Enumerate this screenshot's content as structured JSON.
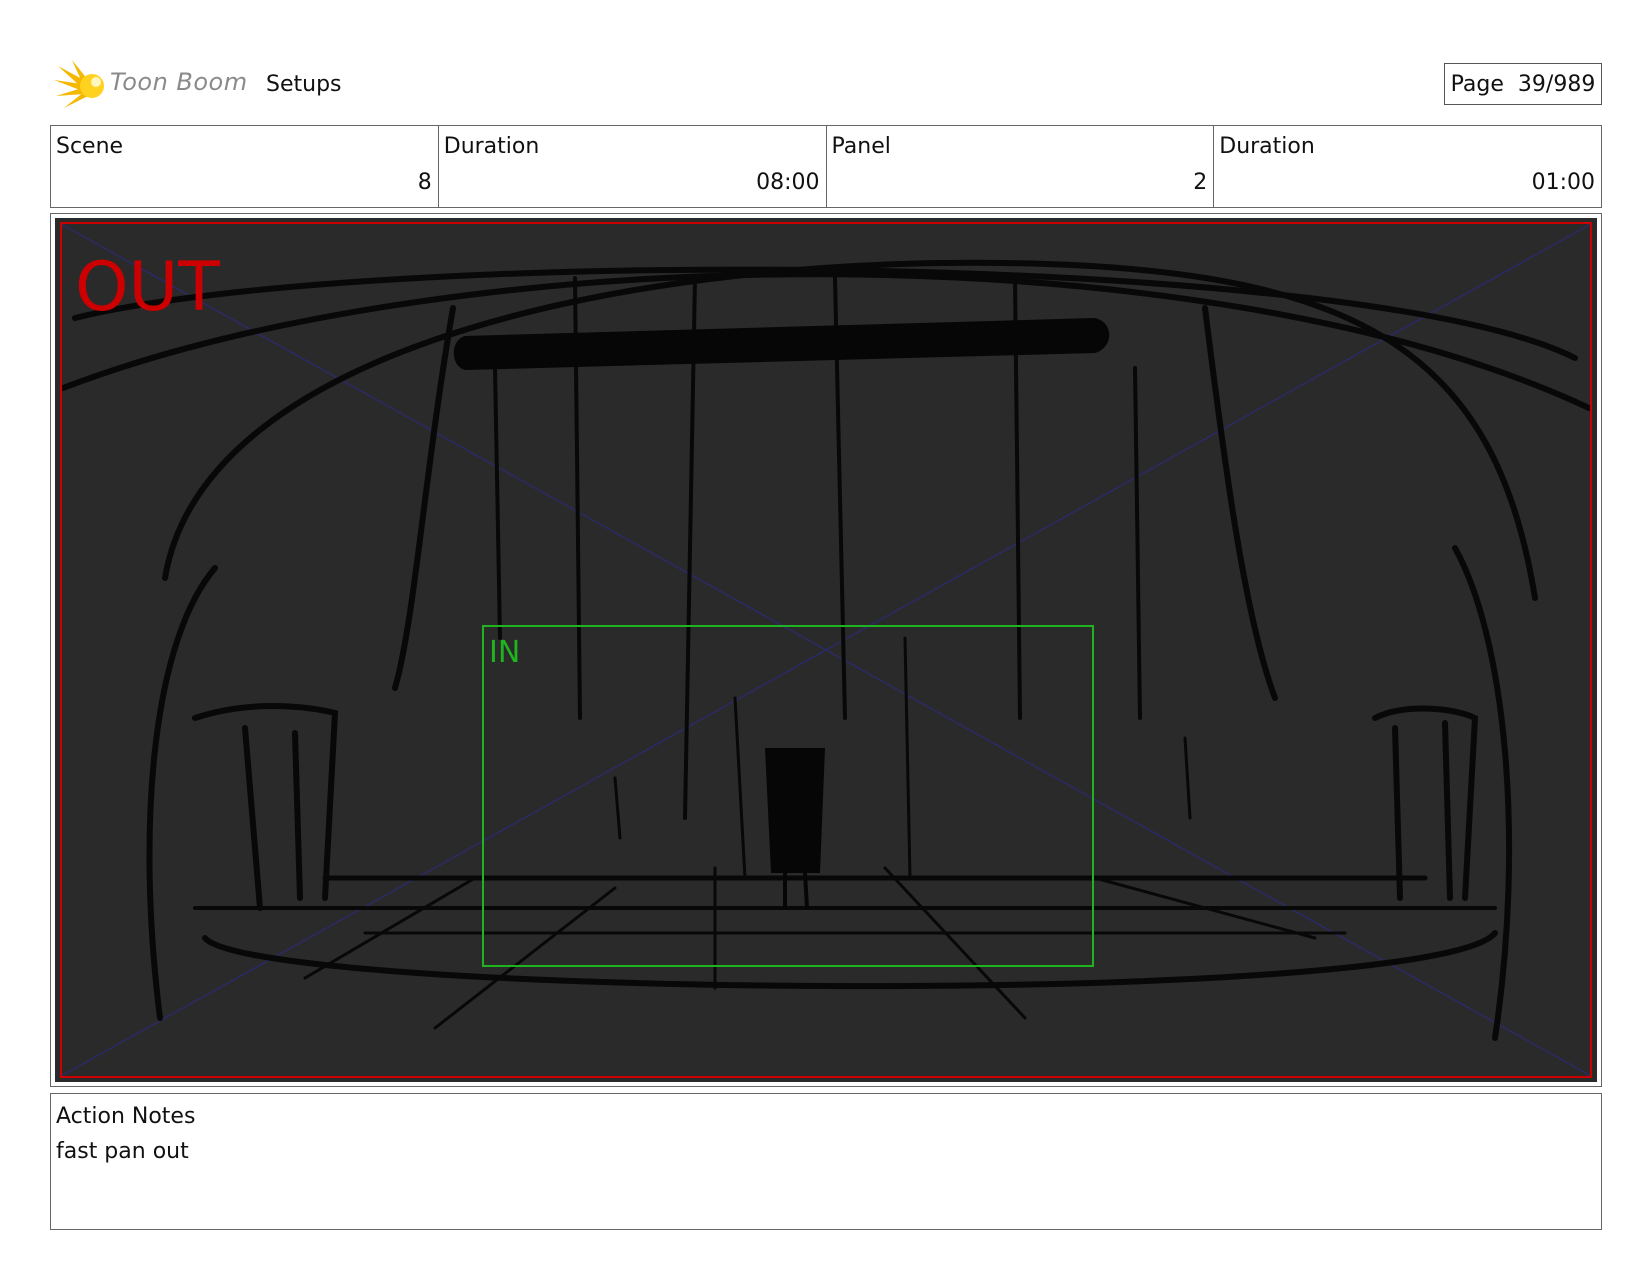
{
  "header": {
    "logo_text": "Toon Boom",
    "project_title": "Setups",
    "page_label": "Page",
    "page_number": "39/989"
  },
  "info": {
    "scene_label": "Scene",
    "scene_value": "8",
    "scene_duration_label": "Duration",
    "scene_duration_value": "08:00",
    "panel_label": "Panel",
    "panel_value": "2",
    "panel_duration_label": "Duration",
    "panel_duration_value": "01:00"
  },
  "panel": {
    "out_label": "OUT",
    "in_label": "IN",
    "out_color": "#cc0000",
    "in_color": "#1fb31f",
    "background_color": "#2a2a2a"
  },
  "notes": {
    "label": "Action Notes",
    "text": "fast pan out"
  }
}
